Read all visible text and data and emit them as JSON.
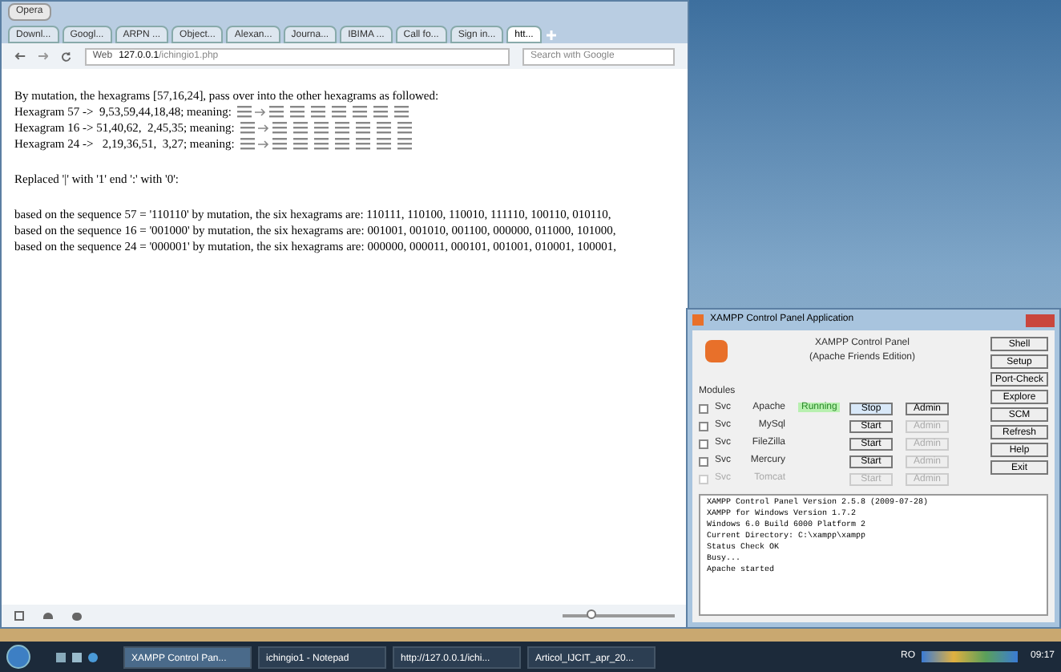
{
  "browser": {
    "app_label": "Opera",
    "tabs": [
      {
        "label": "Downl...",
        "selected": false
      },
      {
        "label": "Googl...",
        "selected": false
      },
      {
        "label": "ARPN ...",
        "selected": false
      },
      {
        "label": "Object...",
        "selected": false
      },
      {
        "label": "Alexan...",
        "selected": false
      },
      {
        "label": "Journa...",
        "selected": false
      },
      {
        "label": "IBIMA ...",
        "selected": false
      },
      {
        "label": "Call fo...",
        "selected": false
      },
      {
        "label": "Sign in...",
        "selected": false
      },
      {
        "label": "htt...",
        "selected": true
      }
    ],
    "address_label": "Web",
    "address_host": "127.0.0.1",
    "address_path": "/ichingio1.php",
    "search_placeholder": "Search with Google",
    "intro": "By mutation, the hexagrams [57,16,24], pass over into the other hexagrams as followed:",
    "hexagram_lines": [
      {
        "prefix": "Hexagram 57 ->  9,53,59,44,18,48; meaning:"
      },
      {
        "prefix": "Hexagram 16 -> 51,40,62,  2,45,35; meaning:"
      },
      {
        "prefix": "Hexagram 24 ->   2,19,36,51,  3,27; meaning:"
      }
    ],
    "replaced": "Replaced '|' with '1' end ':' with '0':",
    "sequences": [
      "based on the sequence 57 = '110110' by mutation, the six hexagrams are: 110111, 110100, 110010, 111110, 100110, 010110,",
      "based on the sequence 16 = '001000' by mutation, the six hexagrams are: 001001, 001010, 001100, 000000, 011000, 101000,",
      "based on the sequence 24 = '000001' by mutation, the six hexagrams are: 000000, 000011, 000101, 001001, 010001, 100001,"
    ],
    "zoom": {
      "level": 0.25
    }
  },
  "xampp": {
    "title": "XAMPP Control Panel Application",
    "heading": "XAMPP Control Panel",
    "subheading": "(Apache Friends Edition)",
    "modules_label": "Modules",
    "modules": [
      {
        "svc": "Svc",
        "svc_checked": false,
        "name": "Apache",
        "status": "Running",
        "action": "Stop",
        "admin": "Admin",
        "admin_disabled": false,
        "disabled": false
      },
      {
        "svc": "Svc",
        "svc_checked": false,
        "name": "MySql",
        "action": "Start",
        "admin": "Admin",
        "admin_disabled": true,
        "disabled": false
      },
      {
        "svc": "Svc",
        "svc_checked": false,
        "name": "FileZilla",
        "action": "Start",
        "admin": "Admin",
        "admin_disabled": true,
        "disabled": false
      },
      {
        "svc": "Svc",
        "svc_checked": false,
        "name": "Mercury",
        "action": "Start",
        "admin": "Admin",
        "admin_disabled": true,
        "disabled": false
      },
      {
        "svc": "Svc",
        "svc_checked": false,
        "name": "Tomcat",
        "action": "Start",
        "admin": "Admin",
        "admin_disabled": true,
        "disabled": true
      }
    ],
    "side_buttons": [
      "Shell",
      "Setup",
      "Port-Check",
      "Explore",
      "SCM",
      "Refresh",
      "Help",
      "Exit"
    ],
    "log": [
      "XAMPP Control Panel Version 2.5.8 (2009-07-28)",
      "XAMPP for Windows Version 1.7.2",
      "Windows 6.0 Build 6000 Platform 2",
      "Current Directory: C:\\xampp\\xampp",
      "Status Check OK",
      "Busy...",
      "Apache started"
    ]
  },
  "taskbar": {
    "items": [
      {
        "label": "XAMPP Control Pan...",
        "selected": true
      },
      {
        "label": "ichingio1 - Notepad",
        "selected": false
      },
      {
        "label": "http://127.0.0.1/ichi...",
        "selected": false
      },
      {
        "label": "Articol_IJCIT_apr_20...",
        "selected": false
      }
    ],
    "language": "RO",
    "clock": "09:17"
  }
}
